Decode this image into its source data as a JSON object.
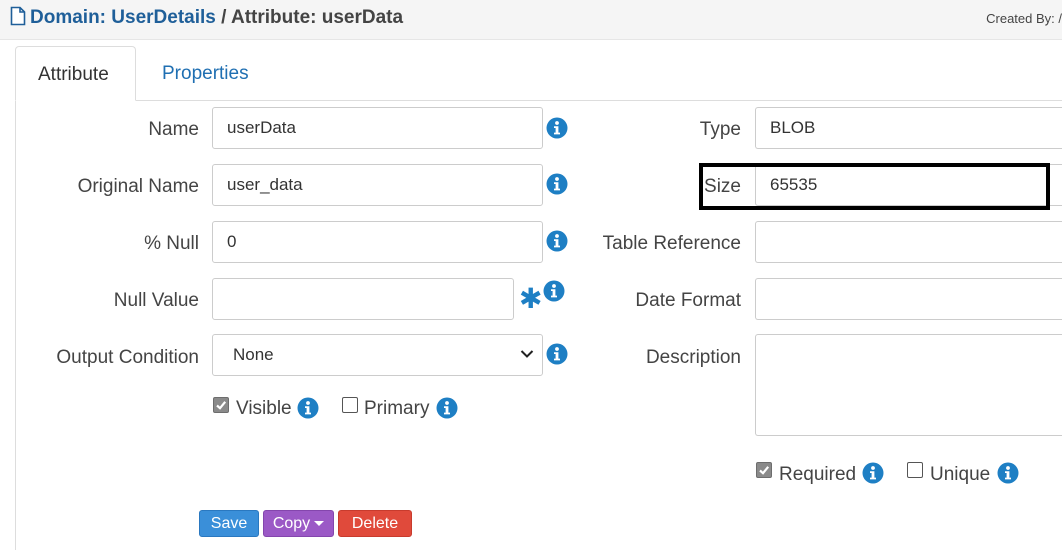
{
  "header": {
    "title_domain": "Domain: UserDetails",
    "title_separator": " / ",
    "title_attribute": "Attribute: userData",
    "created_by": "Created By: /"
  },
  "tabs": [
    {
      "label": "Attribute",
      "active": true
    },
    {
      "label": "Properties",
      "active": false
    }
  ],
  "form": {
    "name": {
      "label": "Name",
      "value": "userData"
    },
    "original_name": {
      "label": "Original Name",
      "value": "user_data"
    },
    "percent_null": {
      "label": "% Null",
      "value": "0"
    },
    "null_value": {
      "label": "Null Value",
      "value": ""
    },
    "output_condition": {
      "label": "Output Condition",
      "selected": "None"
    },
    "visible": {
      "label": "Visible",
      "checked": true
    },
    "primary": {
      "label": "Primary",
      "checked": false
    },
    "type": {
      "label": "Type",
      "value": "BLOB"
    },
    "size": {
      "label": "Size",
      "value": "65535"
    },
    "table_reference": {
      "label": "Table Reference",
      "value": ""
    },
    "date_format": {
      "label": "Date Format",
      "value": ""
    },
    "description": {
      "label": "Description",
      "value": ""
    },
    "required": {
      "label": "Required",
      "checked": true
    },
    "unique": {
      "label": "Unique",
      "checked": false
    }
  },
  "buttons": {
    "save": "Save",
    "copy": "Copy",
    "delete": "Delete"
  },
  "icons": {
    "title": "document-icon",
    "info": "info-icon",
    "required": "asterisk-icon"
  },
  "colors": {
    "link": "#1f5f99",
    "info": "#1e7fc4",
    "save": "#3a8fd9",
    "copy": "#9b59c6",
    "delete": "#e04a3b"
  }
}
